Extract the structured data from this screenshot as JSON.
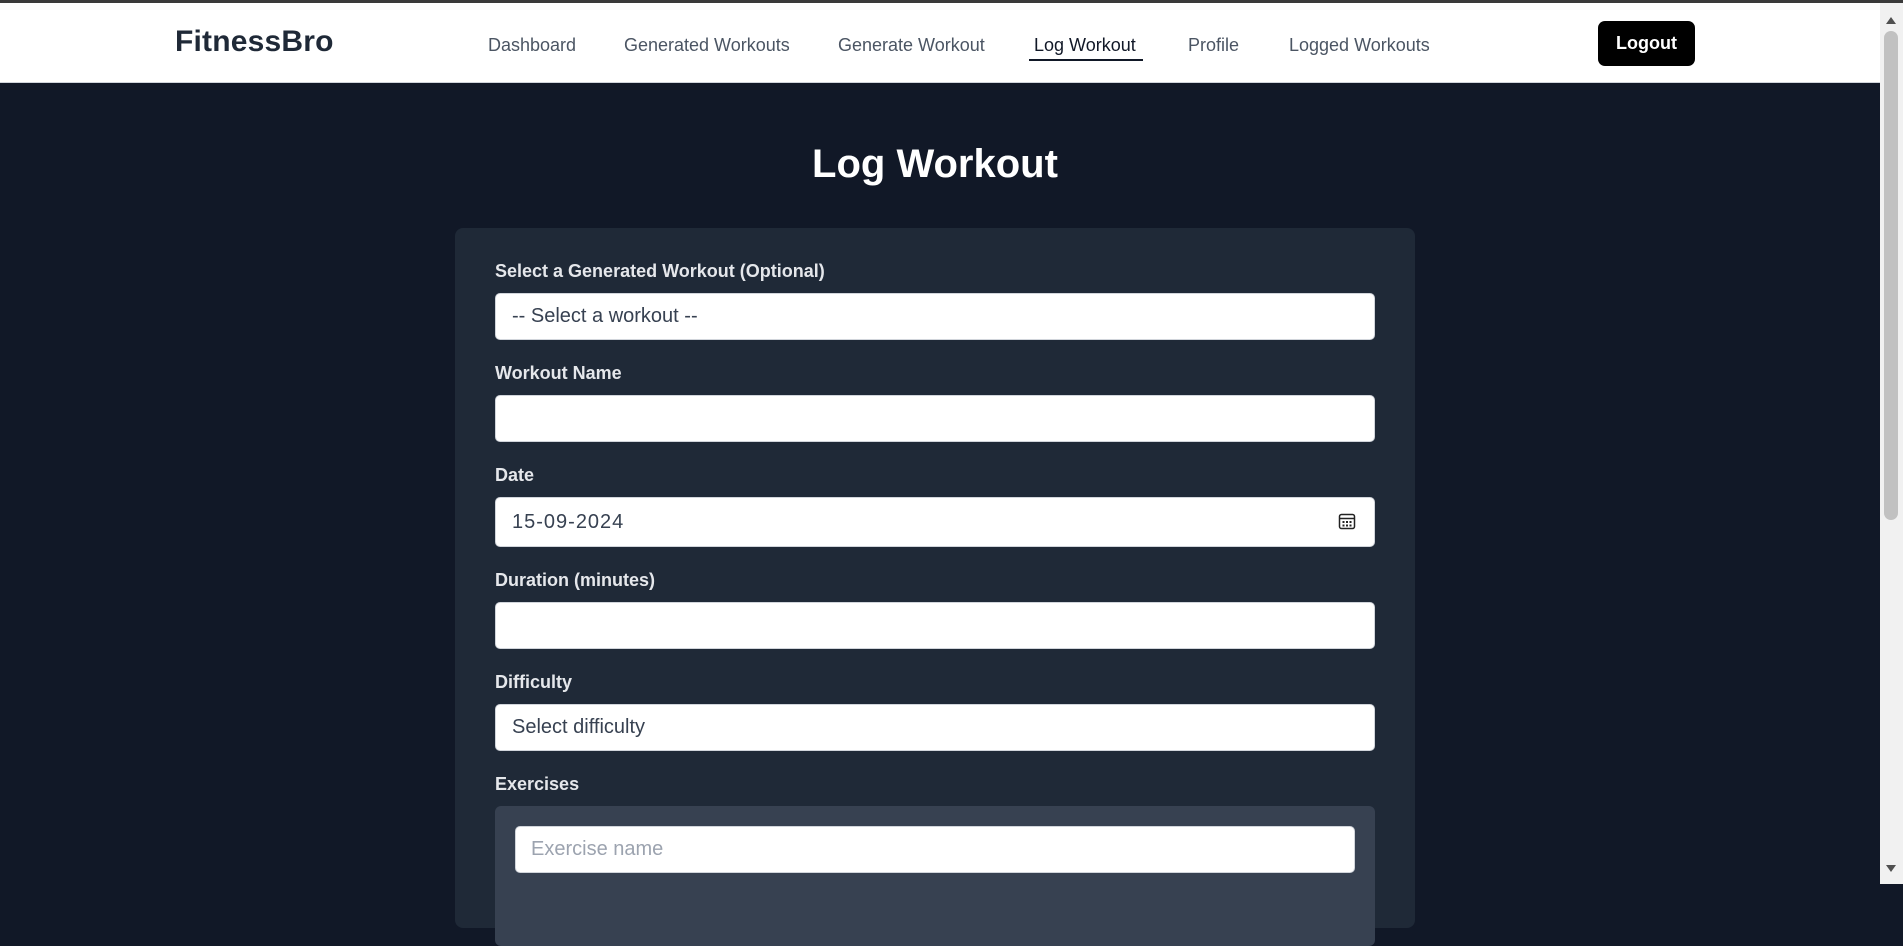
{
  "app": {
    "brand": "FitnessBro"
  },
  "nav": {
    "links": [
      {
        "label": "Dashboard"
      },
      {
        "label": "Generated Workouts"
      },
      {
        "label": "Generate Workout"
      },
      {
        "label": "Log Workout"
      },
      {
        "label": "Profile"
      },
      {
        "label": "Logged Workouts"
      }
    ],
    "active": "Log Workout",
    "logout_label": "Logout"
  },
  "page": {
    "title": "Log Workout"
  },
  "form": {
    "generated_workout": {
      "label": "Select a Generated Workout (Optional)",
      "value": "-- Select a workout --"
    },
    "workout_name": {
      "label": "Workout Name",
      "value": ""
    },
    "date": {
      "label": "Date",
      "value": "15-09-2024"
    },
    "duration": {
      "label": "Duration (minutes)",
      "value": ""
    },
    "difficulty": {
      "label": "Difficulty",
      "value": "Select difficulty"
    },
    "exercises": {
      "label": "Exercises",
      "exercise_name_placeholder": "Exercise name"
    }
  },
  "icons": {
    "date_picker": "calendar-icon"
  },
  "colors": {
    "page_background": "#111827",
    "card_background": "#1f2937",
    "exercise_box_background": "#374151",
    "navbar_background": "#ffffff",
    "logout_button": "#000000"
  }
}
